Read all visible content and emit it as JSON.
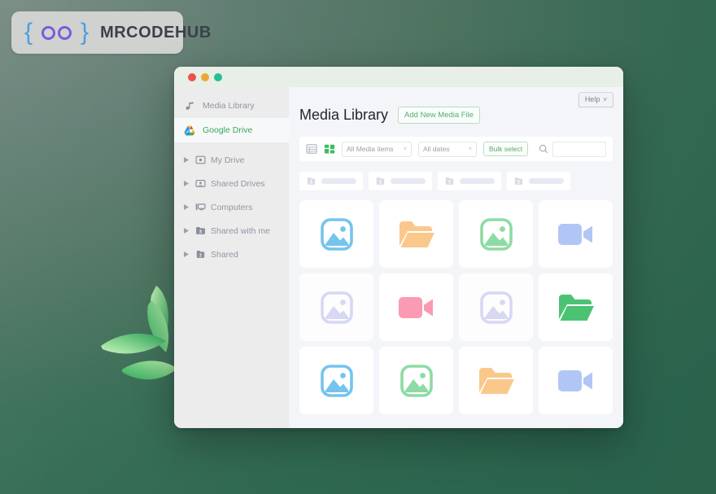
{
  "brand": {
    "logo_left": "{",
    "logo_right": "}",
    "name": "MRCODEHUB",
    "brace_color": "#4a9fe0",
    "circle_color": "#7b5bdb",
    "badge_color": "#cfd2cf"
  },
  "desktop": {
    "background_colors": [
      "#6d8279",
      "#356b53",
      "#2c6750"
    ],
    "decoration": "leaf-cluster-icon"
  },
  "window": {
    "traffic_lights": [
      {
        "name": "close",
        "color": "#e8544a"
      },
      {
        "name": "minimize",
        "color": "#eea735"
      },
      {
        "name": "maximize",
        "color": "#24bf95"
      }
    ]
  },
  "sidebar": {
    "primary": [
      {
        "label": "Media Library",
        "icon": "media-library-icon",
        "active": false
      },
      {
        "label": "Google Drive",
        "icon": "google-drive-icon",
        "active": true
      }
    ],
    "tree": [
      {
        "label": "My Drive",
        "icon": "my-drive-icon"
      },
      {
        "label": "Shared Drives",
        "icon": "shared-drives-icon"
      },
      {
        "label": "Computers",
        "icon": "computers-icon"
      },
      {
        "label": "Shared with me",
        "icon": "shared-with-me-icon"
      },
      {
        "label": "Shared",
        "icon": "shared-folder-icon"
      }
    ],
    "active_color": "#3aa757",
    "text_color": "#9296a1"
  },
  "main": {
    "help_label": "Help",
    "help_caret": "˅",
    "page_title": "Media Library",
    "add_button": "Add New Media File",
    "accent_color": "#4fae6b"
  },
  "toolbar": {
    "view_list_icon": "list-view-icon",
    "view_grid_icon": "grid-view-icon",
    "active_view": "grid",
    "filter_media": {
      "value": "All Media items",
      "caret": "˅"
    },
    "filter_dates": {
      "value": "All dates",
      "caret": "˅"
    },
    "bulk_select": "Bulk select",
    "search": {
      "value": "",
      "placeholder": "",
      "icon": "search-icon"
    }
  },
  "breadcrumbs": [
    {
      "icon": "shared-folder-icon",
      "placeholder_width": 54
    },
    {
      "icon": "shared-folder-icon",
      "placeholder_width": 54
    },
    {
      "icon": "shared-folder-icon",
      "placeholder_width": 54
    },
    {
      "icon": "shared-folder-icon",
      "placeholder_width": 54
    }
  ],
  "media_grid": {
    "columns": 4,
    "items": [
      {
        "type": "image",
        "icon": "image-icon",
        "color": "#74c4ee"
      },
      {
        "type": "folder",
        "icon": "folder-icon",
        "color": "#fbc88c"
      },
      {
        "type": "image",
        "icon": "image-icon",
        "color": "#8ddba4"
      },
      {
        "type": "video",
        "icon": "video-icon",
        "color": "#b2c6f6"
      },
      {
        "type": "image",
        "icon": "image-icon",
        "color": "#d6d8f4"
      },
      {
        "type": "video",
        "icon": "video-icon",
        "color": "#fa9ab3"
      },
      {
        "type": "image",
        "icon": "image-icon",
        "color": "#d6d8f4"
      },
      {
        "type": "folder",
        "icon": "folder-icon",
        "color": "#4cc373"
      },
      {
        "type": "image",
        "icon": "image-icon",
        "color": "#74c4ee"
      },
      {
        "type": "image",
        "icon": "image-icon",
        "color": "#8ddba4"
      },
      {
        "type": "folder",
        "icon": "folder-icon",
        "color": "#fbc88c"
      },
      {
        "type": "video",
        "icon": "video-icon",
        "color": "#b2c6f6"
      }
    ]
  }
}
